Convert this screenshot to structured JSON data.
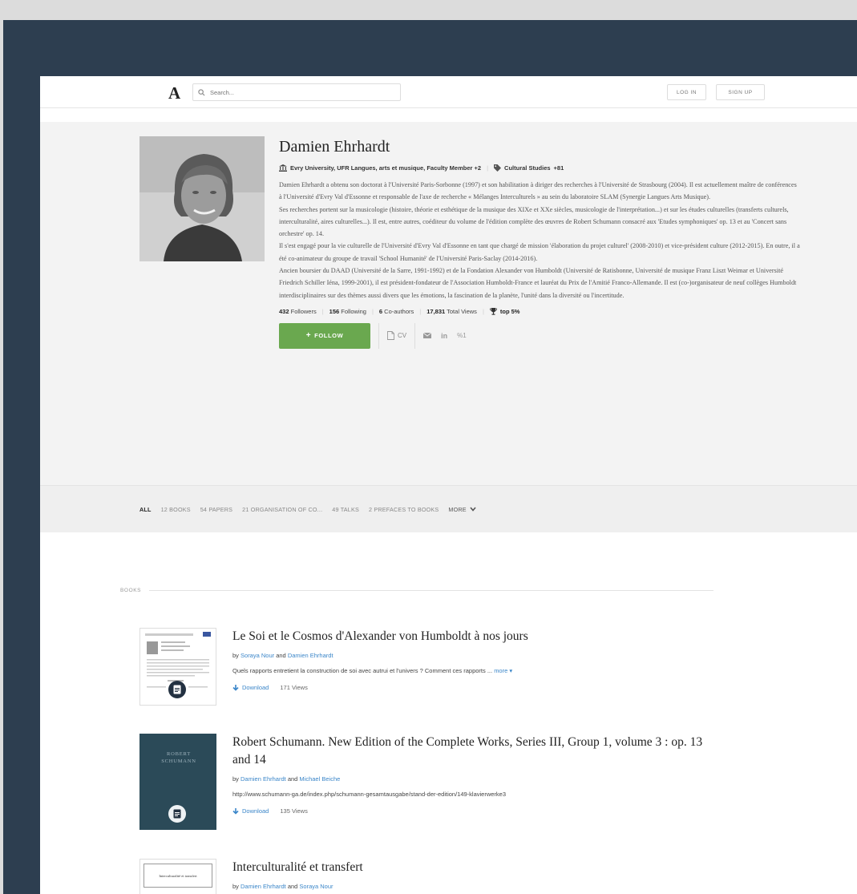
{
  "topnav": {
    "logo": "A",
    "search_placeholder": "Search...",
    "login_label": "LOG IN",
    "signup_label": "SIGN UP"
  },
  "profile": {
    "name": "Damien Ehrhardt",
    "affiliation": "Evry University, UFR Langues, arts et musique, Faculty Member +2",
    "research_interest": "Cultural Studies",
    "research_more": "+81",
    "bio": [
      "Damien Ehrhardt a obtenu son doctorat à l'Université Paris-Sorbonne (1997) et son habilitation à diriger des recherches à l'Université de Strasbourg (2004). Il est actuellement maître de conférences à l'Université d'Evry Val d'Essonne et responsable de l'axe de recherche « Mélanges Interculturels » au sein du laboratoire SLAM (Synergie Langues Arts Musique).",
      "Ses recherches portent sur la musicologie (histoire, théorie et esthétique de la musique des XIXe et XXe siècles, musicologie de l'interprétation...) et sur les études culturelles (transferts culturels, interculturalité, aires culturelles...). Il est, entre autres, coéditeur du volume de l'édition complète des œuvres de Robert Schumann consacré aux 'Etudes symphoniques' op. 13 et au 'Concert sans orchestre' op. 14.",
      "Il s'est engagé pour la vie culturelle de l'Université d'Evry Val d'Essonne en tant que chargé de mission 'élaboration du projet culturel' (2008-2010) et vice-président culture (2012-2015). En outre, il a été co-animateur du groupe de travail 'School Humanité' de l'Université Paris-Saclay (2014-2016).",
      "Ancien boursier du DAAD (Université de la Sarre, 1991-1992) et de la Fondation Alexander von Humboldt (Université de Ratisbonne, Université de musique Franz Liszt Weimar et Université Friedrich Schiller Iéna, 1999-2001), il est président-fondateur de l'Association Humboldt-France et lauréat du Prix de l'Amitié Franco-Allemande. Il est (co-)organisateur de neuf collèges Humboldt interdisciplinaires sur des thèmes aussi divers que les émotions, la fascination de la planète, l'unité dans la diversité ou l'incertitude."
    ],
    "stats": {
      "followers_count": "432",
      "followers_label": "Followers",
      "following_count": "156",
      "following_label": "Following",
      "coauthors_count": "6",
      "coauthors_label": "Co-authors",
      "views_count": "17,831",
      "views_label": "Total Views",
      "rank": "top 5%"
    },
    "follow_label": "FOLLOW",
    "cv_label": "CV",
    "links_count": "1"
  },
  "tabs": {
    "all": "ALL",
    "books": "12 BOOKS",
    "papers": "54 PAPERS",
    "organisation": "21 ORGANISATION OF CO...",
    "talks": "49 TALKS",
    "prefaces": "2 PREFACES TO BOOKS",
    "more": "MORE"
  },
  "books_section_label": "BOOKS",
  "books": [
    {
      "title": "Le Soi et le Cosmos d'Alexander von Humboldt à nos jours",
      "by": "by",
      "author1": "Soraya Nour",
      "and": "and",
      "author2": "Damien Ehrhardt",
      "summary": "Quels rapports entretient la construction de soi avec autrui et l'univers ? Comment ces rapports ...",
      "more": "more",
      "download": "Download",
      "views": "171 Views"
    },
    {
      "title": "Robert Schumann. New Edition of the Complete Works, Series III, Group 1, volume 3 : op. 13 and 14",
      "by": "by",
      "author1": "Damien Ehrhardt",
      "and": "and",
      "author2": "Michael Beiche",
      "summary": "http://www.schumann-ga.de/index.php/schumann-gesamtausgabe/stand-der-edition/149-klavierwerke3",
      "cover_text_1": "ROBERT",
      "cover_text_2": "SCHUMANN",
      "download": "Download",
      "views": "135 Views"
    },
    {
      "title": "Interculturalité et transfert",
      "by": "by",
      "author1": "Damien Ehrhardt",
      "and": "and",
      "author2": "Soraya Nour",
      "cover_text": "Interculturalité et transfert"
    }
  ],
  "colors": {
    "frame_bg": "#2d3e50",
    "follow_green": "#6aa84f",
    "link_blue": "#3b86c9",
    "badge_navy": "#233141"
  }
}
